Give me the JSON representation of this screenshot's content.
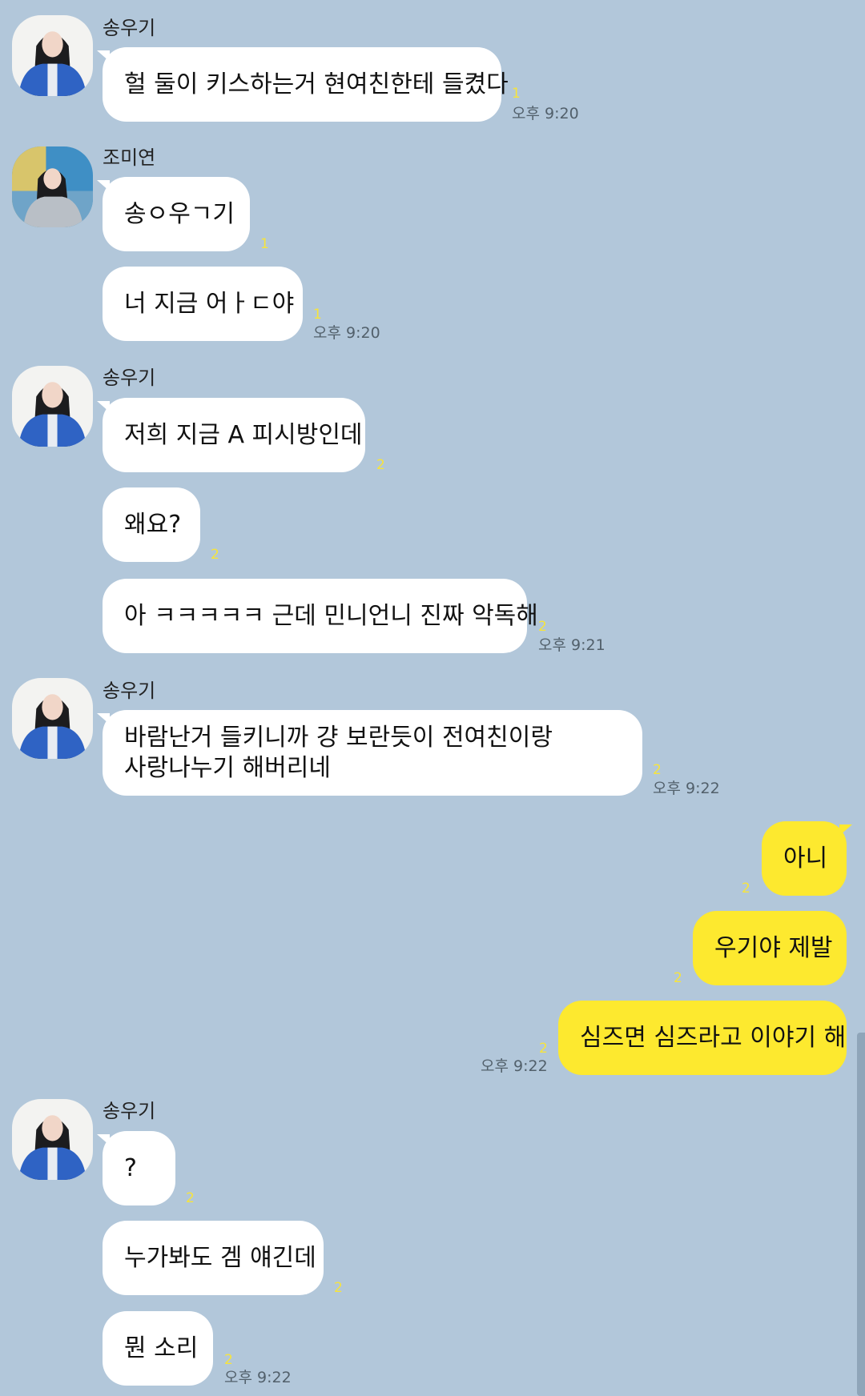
{
  "chat": {
    "colors": {
      "background": "#b2c7da",
      "incoming_bubble": "#ffffff",
      "outgoing_bubble": "#fde92f",
      "unread_count": "#f7e43c"
    },
    "groups": [
      {
        "sender": "송우기",
        "messages": [
          {
            "text": "헐 둘이 키스하는거 현여친한테 들켰다",
            "unread": "1",
            "time": "오후 9:20"
          }
        ]
      },
      {
        "sender": "조미연",
        "messages": [
          {
            "text": "송ㅇ우ㄱ기",
            "unread": "1"
          },
          {
            "text": "너 지금 어ㅏㄷ야",
            "unread": "1",
            "time": "오후 9:20"
          }
        ]
      },
      {
        "sender": "송우기",
        "messages": [
          {
            "text": "저희 지금 A 피시방인데",
            "unread": "2"
          },
          {
            "text": "왜요?",
            "unread": "2"
          },
          {
            "text": "아 ㅋㅋㅋㅋㅋ 근데 민니언니 진짜 악독해",
            "unread": "2",
            "time": "오후 9:21"
          }
        ]
      },
      {
        "sender": "송우기",
        "messages": [
          {
            "line1": "바람난거 들키니까 걍 보란듯이 전여친이랑",
            "line2": "사랑나누기 해버리네",
            "unread": "2",
            "time": "오후 9:22"
          }
        ]
      },
      {
        "sender": "me",
        "messages": [
          {
            "text": "아니",
            "unread": "2"
          },
          {
            "text": "우기야 제발",
            "unread": "2"
          },
          {
            "text": "심즈면 심즈라고 이야기 해",
            "unread": "2",
            "time": "오후 9:22"
          }
        ]
      },
      {
        "sender": "송우기",
        "messages": [
          {
            "text": "?",
            "unread": "2"
          },
          {
            "text": "누가봐도 겜 얘긴데",
            "unread": "2"
          },
          {
            "text": "뭔 소리",
            "unread": "2",
            "time": "오후 9:22"
          }
        ]
      }
    ]
  }
}
